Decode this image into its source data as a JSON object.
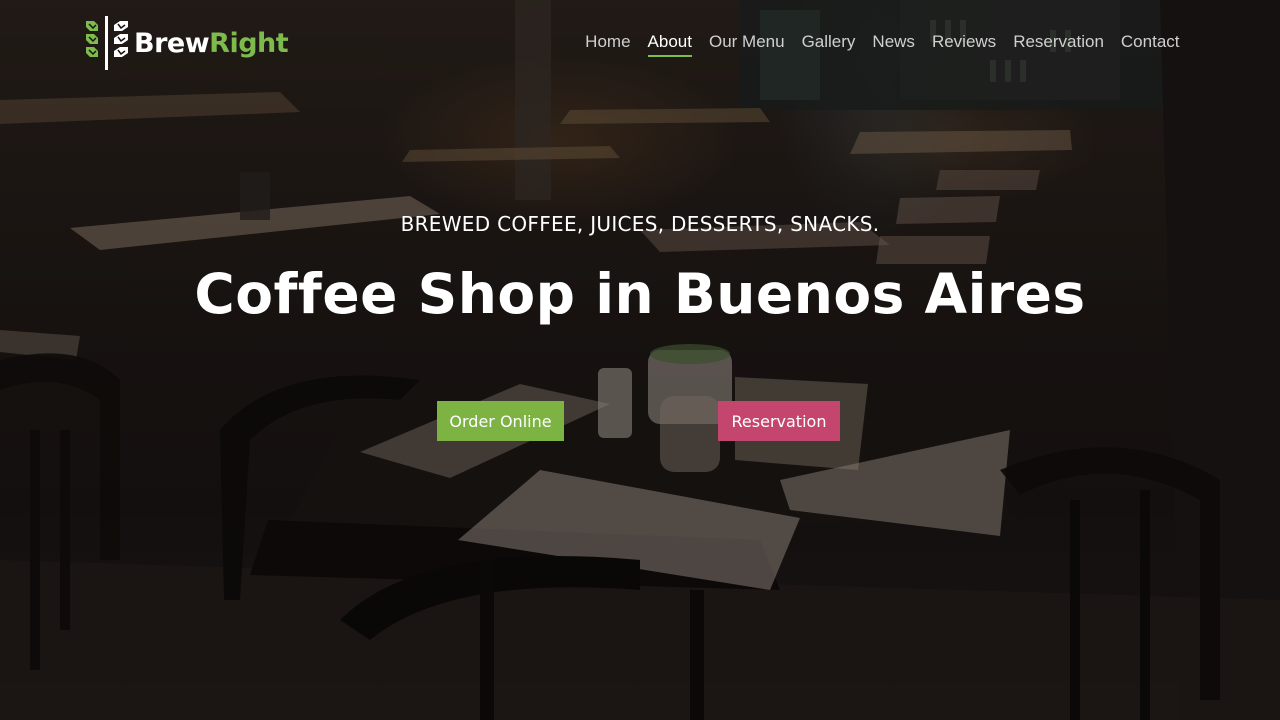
{
  "brand": {
    "name_part1": "Brew",
    "name_part2": "Right",
    "accent": "#7dbb4d"
  },
  "nav": {
    "items": [
      {
        "label": "Home",
        "active": false
      },
      {
        "label": "About",
        "active": true
      },
      {
        "label": "Our Menu",
        "active": false
      },
      {
        "label": "Gallery",
        "active": false
      },
      {
        "label": "News",
        "active": false
      },
      {
        "label": "Reviews",
        "active": false
      },
      {
        "label": "Reservation",
        "active": false
      },
      {
        "label": "Contact",
        "active": false
      }
    ]
  },
  "hero": {
    "tagline": "BREWED COFFEE, JUICES, DESSERTS, SNACKS.",
    "title": "Coffee Shop in Buenos Aires",
    "order_button": "Order Online",
    "reservation_button": "Reservation",
    "order_color": "#7cb342",
    "reservation_color": "#c4466f"
  }
}
